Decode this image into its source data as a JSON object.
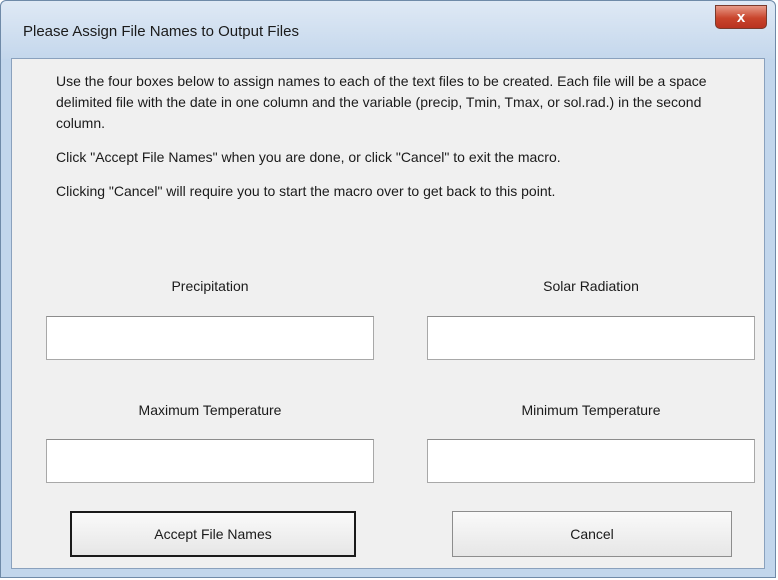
{
  "window": {
    "title": "Please Assign File Names to Output Files",
    "close_label": "x"
  },
  "instructions": [
    "Use the four boxes below to assign names to each of the text files to be created. Each file will be a space delimited file with the date in one column and the variable (precip, Tmin, Tmax, or sol.rad.) in the second column.",
    "Click \"Accept File Names\" when you are done, or click \"Cancel\" to exit the macro.",
    "Clicking \"Cancel\" will require you to start the macro over to get back to this point."
  ],
  "fields": {
    "precipitation": {
      "label": "Precipitation",
      "value": ""
    },
    "solar_radiation": {
      "label": "Solar Radiation",
      "value": ""
    },
    "maximum_temperature": {
      "label": "Maximum Temperature",
      "value": ""
    },
    "minimum_temperature": {
      "label": "Minimum Temperature",
      "value": ""
    }
  },
  "buttons": {
    "accept": "Accept File Names",
    "cancel": "Cancel"
  }
}
